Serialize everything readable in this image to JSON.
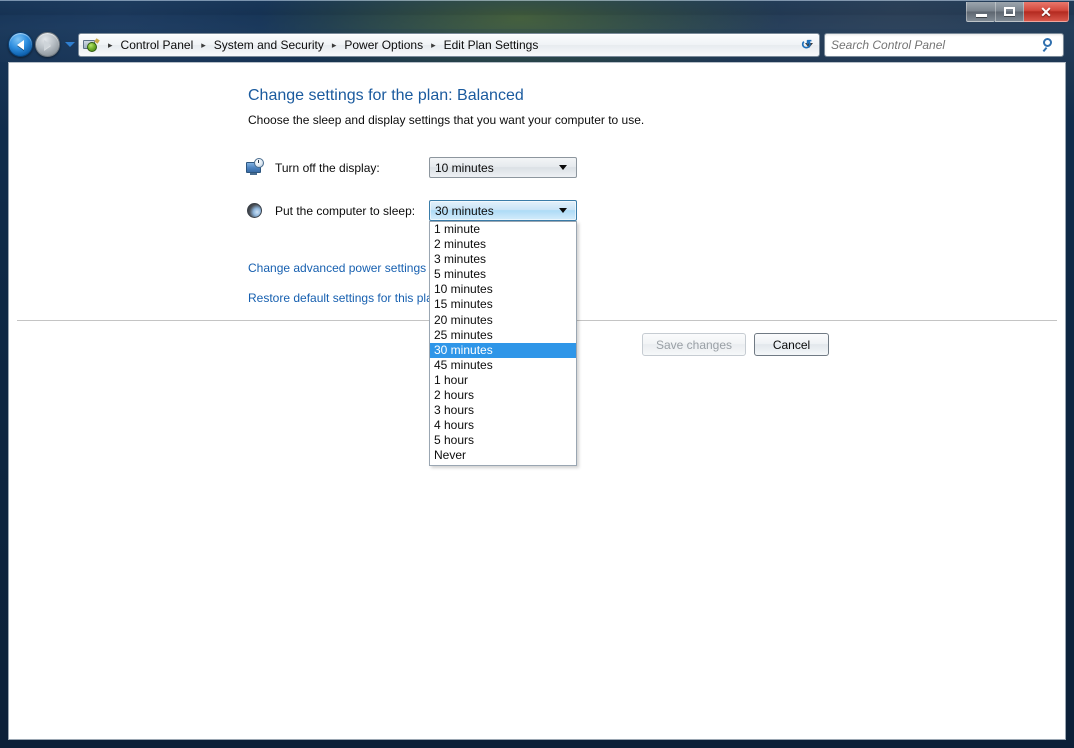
{
  "window": {
    "controls": {
      "minimize_label": "–",
      "maximize_label": "",
      "close_label": "✕"
    }
  },
  "navigation": {
    "back_tooltip": "Back",
    "forward_tooltip": "Forward",
    "recent_pages_tooltip": "Recent Pages",
    "refresh_label": "↺",
    "breadcrumb": [
      "Control Panel",
      "System and Security",
      "Power Options",
      "Edit Plan Settings"
    ],
    "separator": "▸"
  },
  "search": {
    "placeholder": "Search Control Panel",
    "value": ""
  },
  "page": {
    "title": "Change settings for the plan: Balanced",
    "subtitle": "Choose the sleep and display settings that you want your computer to use."
  },
  "settings": {
    "display": {
      "label": "Turn off the display:",
      "value": "10 minutes",
      "icon": "monitor-clock-icon"
    },
    "sleep": {
      "label": "Put the computer to sleep:",
      "value": "30 minutes",
      "icon": "moon-sleep-icon"
    }
  },
  "dropdown": {
    "open": true,
    "selected": "30 minutes",
    "options": [
      "1 minute",
      "2 minutes",
      "3 minutes",
      "5 minutes",
      "10 minutes",
      "15 minutes",
      "20 minutes",
      "25 minutes",
      "30 minutes",
      "45 minutes",
      "1 hour",
      "2 hours",
      "3 hours",
      "4 hours",
      "5 hours",
      "Never"
    ]
  },
  "links": {
    "advanced": "Change advanced power settings",
    "restore": "Restore default settings for this plan"
  },
  "buttons": {
    "save": "Save changes",
    "save_enabled": false,
    "cancel": "Cancel",
    "cancel_enabled": true
  },
  "colors": {
    "title_blue": "#1a5a9e",
    "link_blue": "#1760b0",
    "selection_blue": "#2f96e8",
    "close_red": "#c0392b"
  }
}
